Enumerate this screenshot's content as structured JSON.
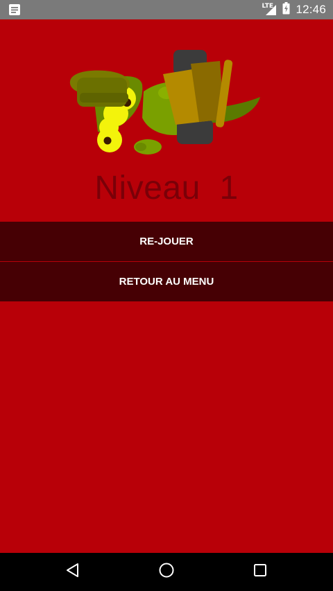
{
  "status_bar": {
    "network_label": "LTE",
    "time": "12:46"
  },
  "level": {
    "title": "Niveau  1"
  },
  "buttons": {
    "replay_label": "RE-JOUER",
    "menu_label": "RETOUR AU MENU"
  },
  "colors": {
    "background": "#b80008",
    "button_bg": "#460004",
    "title": "#7a0008",
    "status_bar": "#7a7a7a",
    "nav_bar": "#000000"
  },
  "icons": {
    "status_left": "notification-doc-icon",
    "signal": "signal-icon",
    "battery": "battery-charging-icon",
    "nav_back": "back-triangle-icon",
    "nav_home": "home-circle-icon",
    "nav_recents": "recents-square-icon"
  }
}
